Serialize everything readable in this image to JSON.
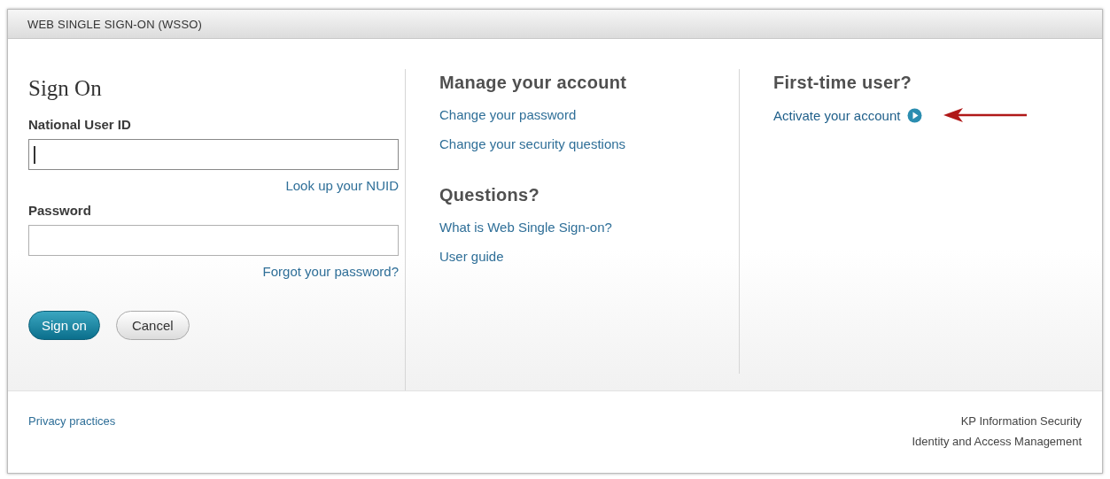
{
  "header": {
    "title": "WEB SINGLE SIGN-ON (WSSO)"
  },
  "sign_on": {
    "heading": "Sign On",
    "fields": [
      {
        "label": "National User ID",
        "focused": true,
        "link": "Look up your NUID"
      },
      {
        "label": "Password",
        "focused": false,
        "link": "Forgot your password?"
      }
    ],
    "buttons": [
      {
        "label": "Sign on",
        "kind": "primary"
      },
      {
        "label": "Cancel",
        "kind": "secondary"
      }
    ]
  },
  "sections": [
    {
      "heading": "Manage your account",
      "links": [
        "Change your password",
        "Change your security questions"
      ]
    },
    {
      "heading": "Questions?",
      "links": [
        "What is Web Single Sign-on?",
        "User guide"
      ]
    }
  ],
  "first_time": {
    "heading": "First-time user?",
    "link": "Activate your account"
  },
  "footer": {
    "link": "Privacy practices",
    "credits": [
      "KP Information Security",
      "Identity and Access Management"
    ]
  }
}
